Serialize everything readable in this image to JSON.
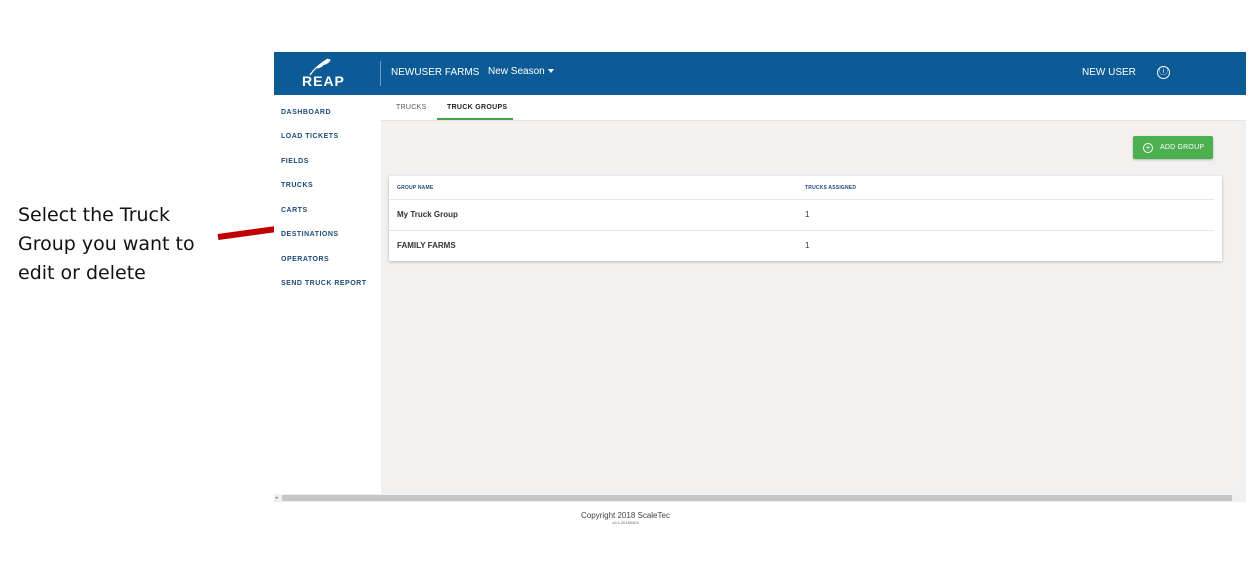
{
  "annotation": {
    "line1": "Select the Truck",
    "line2": "Group you want to",
    "line3": "edit or delete",
    "arrow_color": "#c00000"
  },
  "header": {
    "logo_text": "REAP",
    "farm_name": "NEWUSER FARMS",
    "season_label": "New Season",
    "user_name": "NEW USER",
    "info_icon": "ⓘ",
    "bar_color": "#0d5b96"
  },
  "sidebar": {
    "items": [
      {
        "label": "DASHBOARD"
      },
      {
        "label": "LOAD TICKETS"
      },
      {
        "label": "FIELDS"
      },
      {
        "label": "TRUCKS"
      },
      {
        "label": "CARTS"
      },
      {
        "label": "DESTINATIONS"
      },
      {
        "label": "OPERATORS"
      },
      {
        "label": "SEND TRUCK REPORT"
      }
    ]
  },
  "tabs": [
    {
      "label": "TRUCKS",
      "active": false
    },
    {
      "label": "TRUCK GROUPS",
      "active": true
    }
  ],
  "toolbar": {
    "add_group_label": "ADD GROUP",
    "add_group_icon": "+",
    "button_color": "#4caf50"
  },
  "table": {
    "headers": [
      "GROUP NAME",
      "TRUCKS ASSIGNED"
    ],
    "rows": [
      {
        "name": "My Truck Group",
        "trucks": "1"
      },
      {
        "name": "FAMILY FARMS",
        "trucks": "1"
      }
    ]
  },
  "footer": {
    "copyright": "Copyright 2018 ScaleTec",
    "version": "v0.1.20180403"
  }
}
